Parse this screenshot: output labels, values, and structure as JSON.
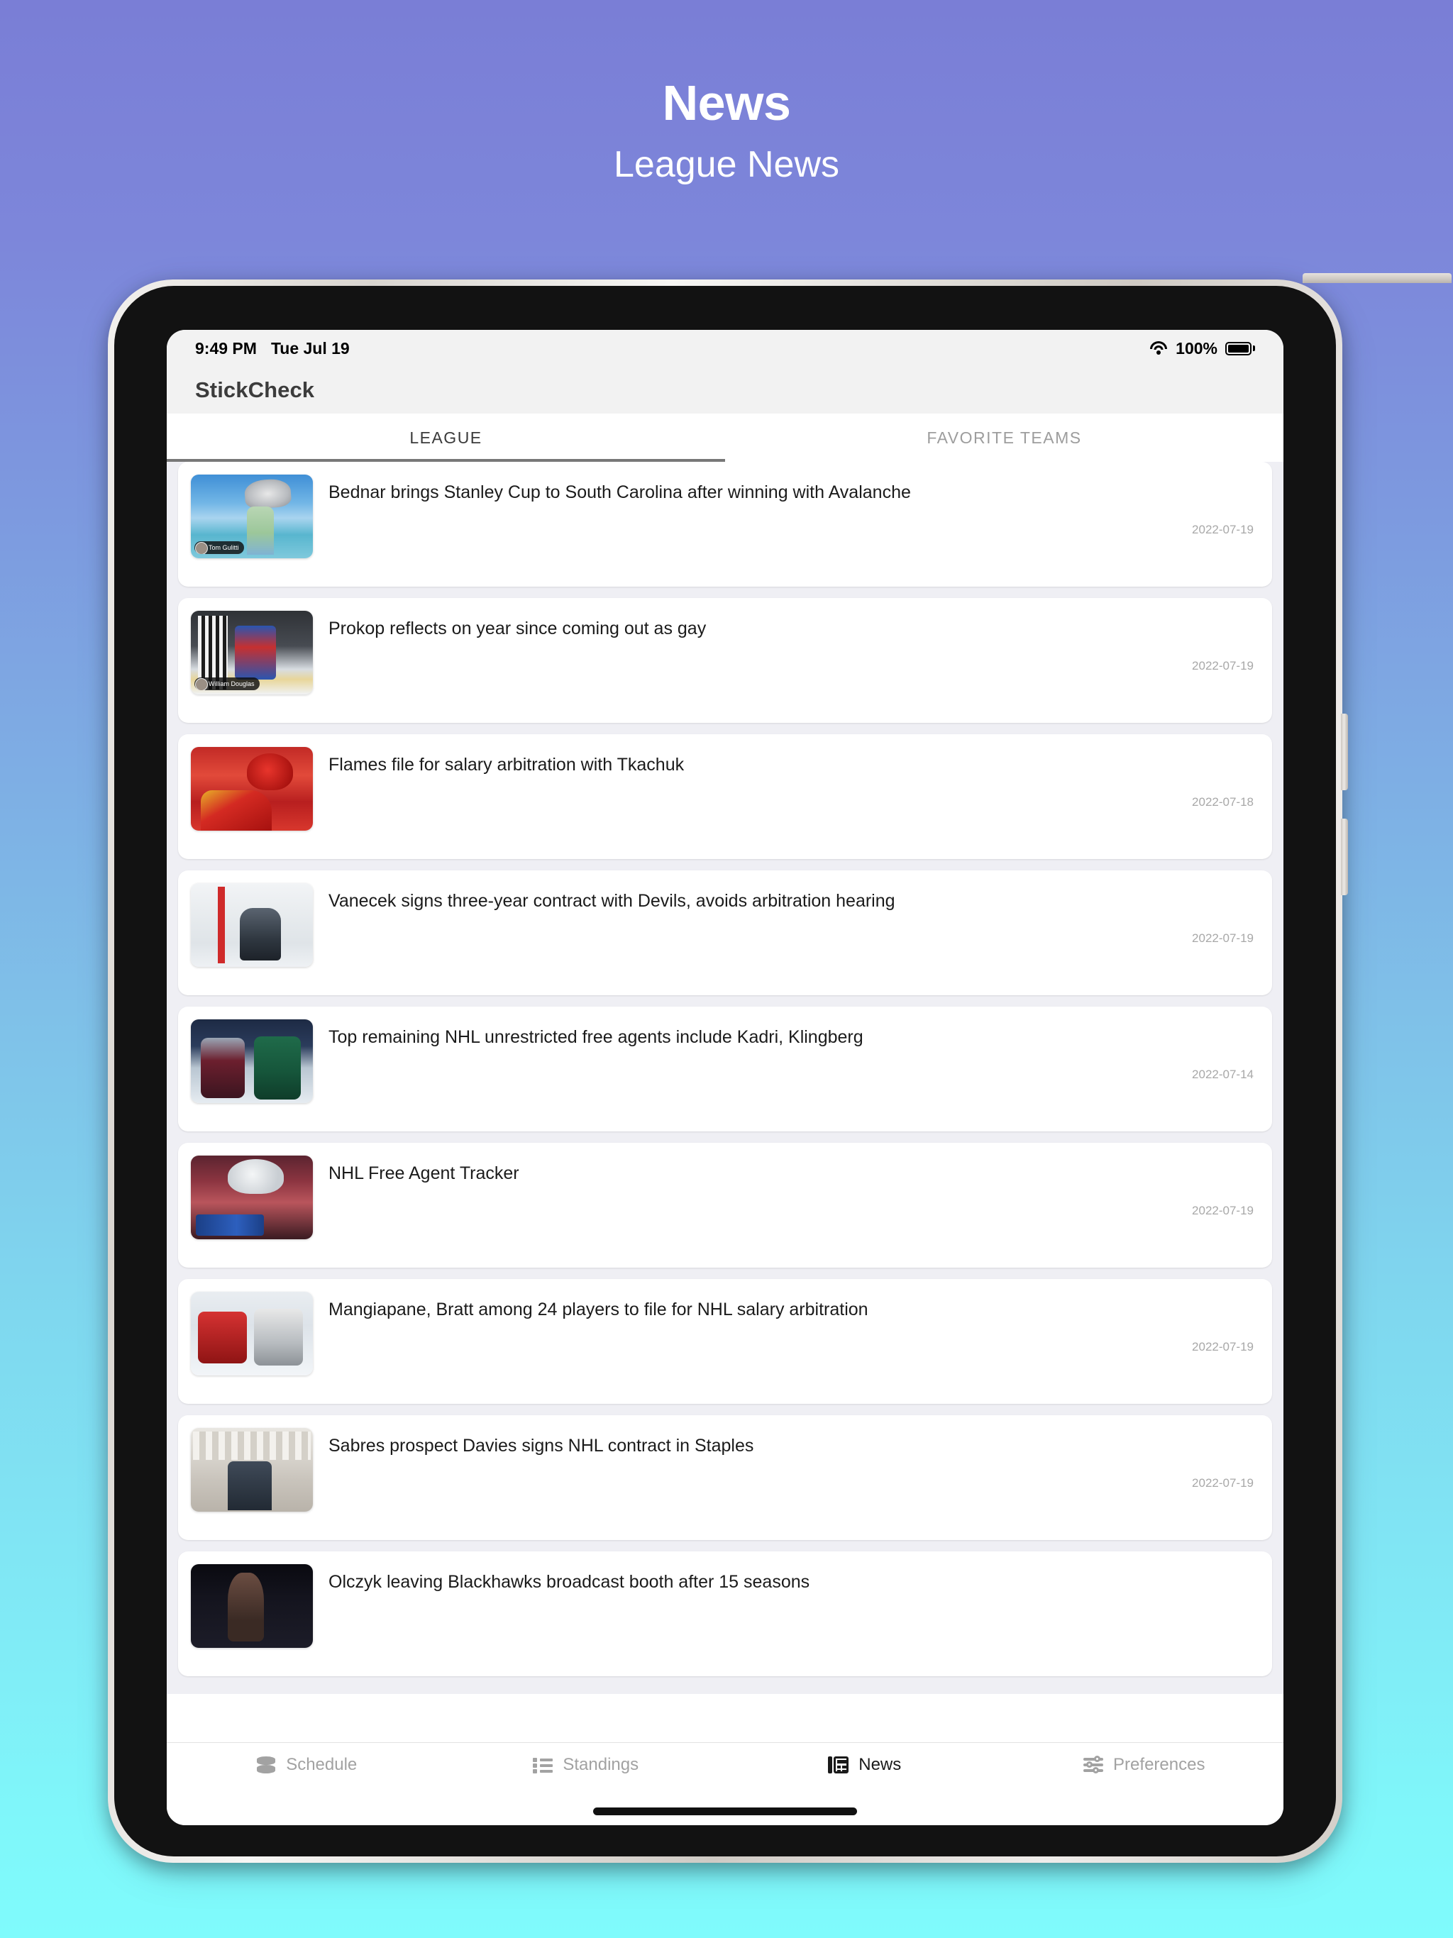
{
  "page": {
    "title": "News",
    "subtitle": "League News",
    "background_gradient_from": "#7a7ed6",
    "background_gradient_to": "#7ffbfc"
  },
  "status_bar": {
    "time": "9:49 PM",
    "date": "Tue Jul 19",
    "battery_percent": "100%",
    "wifi_icon": "wifi-icon",
    "battery_icon": "battery-icon"
  },
  "app_bar": {
    "title": "StickCheck"
  },
  "segment_tabs": [
    {
      "label": "LEAGUE",
      "active": true
    },
    {
      "label": "FAVORITE TEAMS",
      "active": false
    }
  ],
  "news": [
    {
      "title": "Bednar brings Stanley Cup to South Carolina after winning with Avalanche",
      "date": "2022-07-19",
      "thumb_caption": "Tom Gulitti",
      "thumb_art": "art-cup"
    },
    {
      "title": "Prokop reflects on year since coming out as gay",
      "date": "2022-07-19",
      "thumb_caption": "William Douglas",
      "thumb_art": "art-ref"
    },
    {
      "title": "Flames file for salary arbitration with Tkachuk",
      "date": "2022-07-18",
      "thumb_caption": "",
      "thumb_art": "art-flames"
    },
    {
      "title": "Vanecek signs three-year contract with Devils, avoids arbitration hearing",
      "date": "2022-07-19",
      "thumb_caption": "",
      "thumb_art": "art-goalie"
    },
    {
      "title": "Top remaining NHL unrestricted free agents include Kadri, Klingberg",
      "date": "2022-07-14",
      "thumb_caption": "",
      "thumb_art": "art-skaters"
    },
    {
      "title": "NHL Free Agent Tracker",
      "date": "2022-07-19",
      "thumb_caption": "",
      "thumb_art": "art-fa"
    },
    {
      "title": "Mangiapane, Bratt among 24 players to file for NHL salary arbitration",
      "date": "2022-07-19",
      "thumb_caption": "",
      "thumb_art": "art-devils"
    },
    {
      "title": "Sabres prospect Davies signs NHL contract in Staples",
      "date": "2022-07-19",
      "thumb_caption": "",
      "thumb_art": "art-store"
    },
    {
      "title": "Olczyk leaving Blackhawks broadcast booth after 15 seasons",
      "date": "",
      "thumb_caption": "",
      "thumb_art": "art-booth"
    }
  ],
  "tab_bar": [
    {
      "label": "Schedule",
      "icon": "puck-icon",
      "active": false
    },
    {
      "label": "Standings",
      "icon": "list-icon",
      "active": false
    },
    {
      "label": "News",
      "icon": "newspaper-icon",
      "active": true
    },
    {
      "label": "Preferences",
      "icon": "sliders-icon",
      "active": false
    }
  ]
}
